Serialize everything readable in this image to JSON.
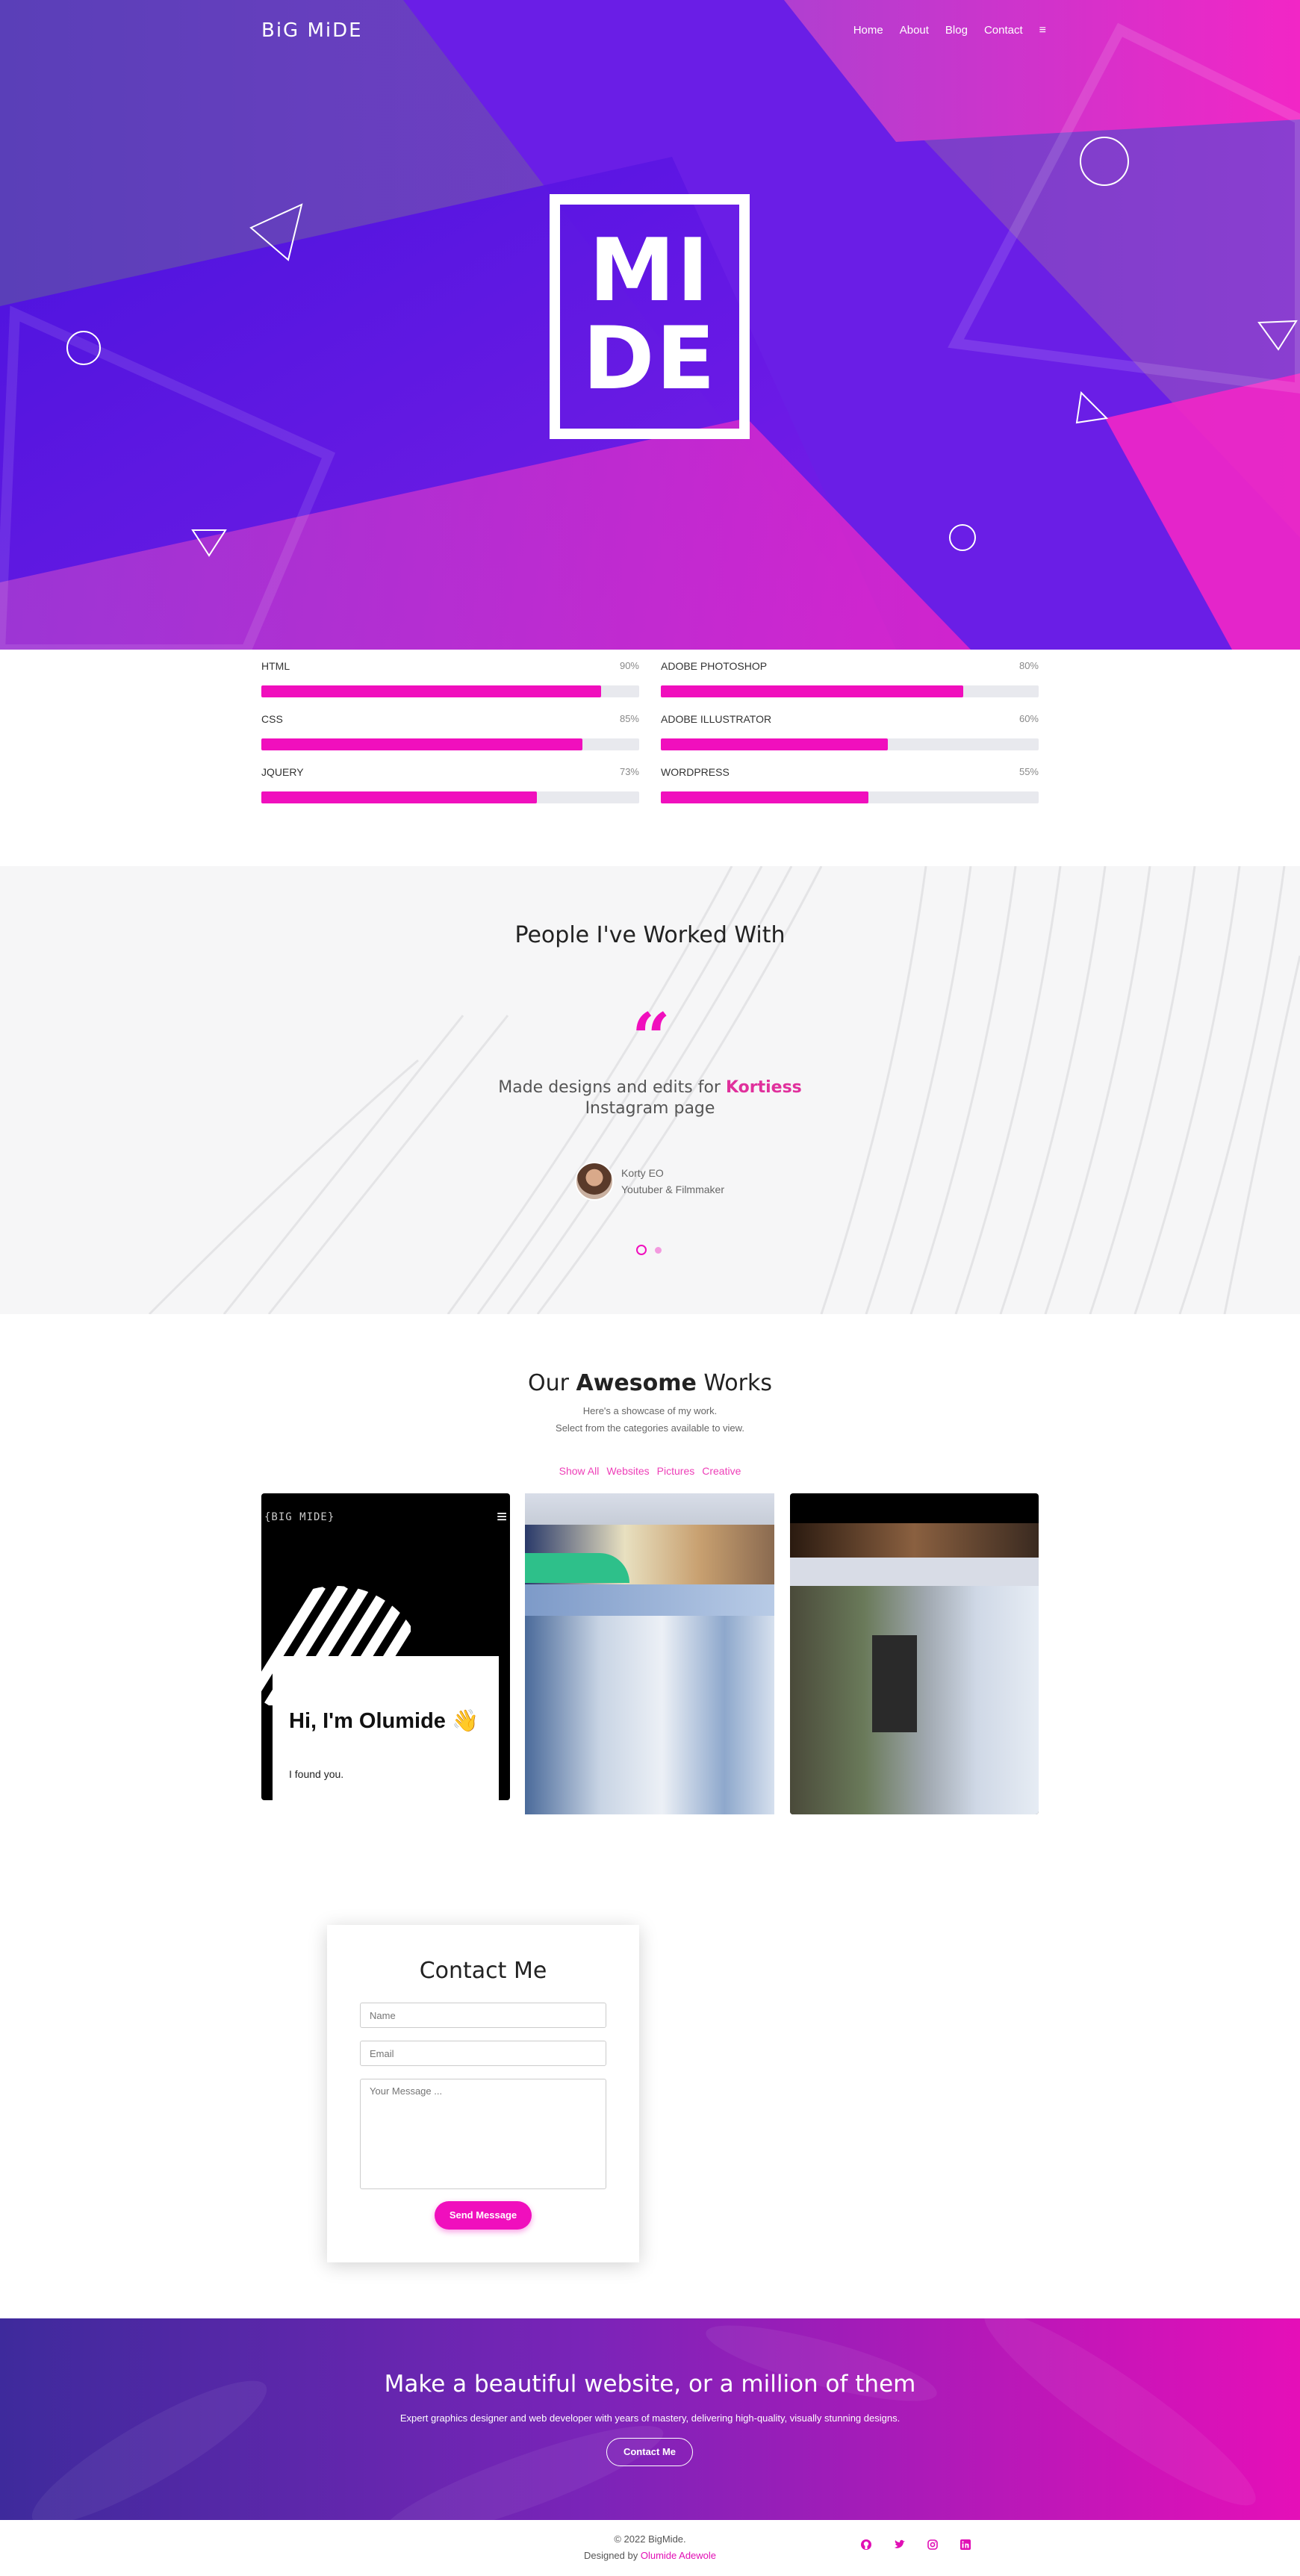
{
  "header": {
    "brand": "BiG MiDE",
    "nav": [
      "Home",
      "About",
      "Blog",
      "Contact"
    ],
    "menu_icon": "hamburger-icon"
  },
  "hero": {
    "logo_line1": "MI",
    "logo_line2": "DE"
  },
  "skills": [
    {
      "name": "HTML",
      "percent_label": "90%",
      "value": 90
    },
    {
      "name": "ADOBE PHOTOSHOP",
      "percent_label": "80%",
      "value": 80
    },
    {
      "name": "CSS",
      "percent_label": "85%",
      "value": 85
    },
    {
      "name": "ADOBE ILLUSTRATOR",
      "percent_label": "60%",
      "value": 60
    },
    {
      "name": "JQUERY",
      "percent_label": "73%",
      "value": 73
    },
    {
      "name": "WORDPRESS",
      "percent_label": "55%",
      "value": 55
    }
  ],
  "testimonials": {
    "title": "People I've Worked With",
    "quote_prefix": "Made designs and edits for",
    "quote_highlight": "Kortiess",
    "quote_suffix": "Instagram page",
    "author_name": "Korty EO",
    "author_role": "Youtuber & Filmmaker"
  },
  "works": {
    "title_pre": "Our",
    "title_bold": "Awesome",
    "title_post": "Works",
    "subtitle1": "Here's a showcase of my work.",
    "subtitle2": "Select from the categories available to view.",
    "filters": [
      "Show All",
      "Websites",
      "Pictures",
      "Creative"
    ],
    "card1_brand": "{BIG MIDE}",
    "card1_heading": "Hi, I'm Olumide 👋",
    "card1_text": "I found you."
  },
  "contact": {
    "title": "Contact Me",
    "name_placeholder": "Name",
    "email_placeholder": "Email",
    "message_placeholder": "Your Message ...",
    "submit_label": "Send Message"
  },
  "cta": {
    "title": "Make a beautiful website, or a million of them",
    "subtitle": "Expert graphics designer and web developer with years of mastery, delivering high-quality, visually stunning designs.",
    "button": "Contact Me"
  },
  "footer": {
    "copyright": "© 2022 BigMide.",
    "designed_by": "Designed by",
    "designer": "Olumide Adewole",
    "social_icons": [
      "github-icon",
      "twitter-icon",
      "instagram-icon",
      "linkedin-icon"
    ]
  },
  "colors": {
    "accent": "#f00fbd",
    "hero_purple": "#6a1ee6",
    "hero_pink": "#f226c6"
  }
}
